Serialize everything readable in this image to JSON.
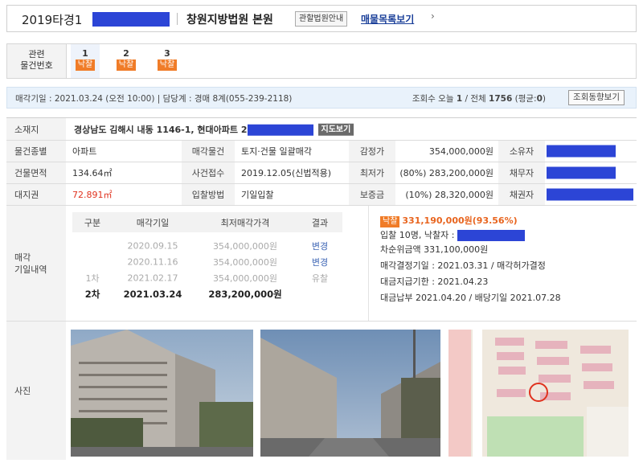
{
  "header": {
    "case_no": "2019타경1",
    "court": "창원지방법원 본원",
    "court_btn": "관할법원안내",
    "list_link": "매물목록보기",
    "chevron": "›"
  },
  "related": {
    "label_line1": "관련",
    "label_line2": "물건번호",
    "items": [
      {
        "num": "1",
        "status": "낙찰"
      },
      {
        "num": "2",
        "status": "낙찰"
      },
      {
        "num": "3",
        "status": "낙찰"
      }
    ]
  },
  "infobar": {
    "left": "매각기일 : 2021.03.24 (오전 10:00) | 담당계 : 경매 8계(055-239-2118)",
    "views_prefix": "조회수 오늘",
    "views_today": "1",
    "views_mid": "/ 전체",
    "views_total": "1756",
    "views_avg_prefix": "(평균:",
    "views_avg": "0",
    "views_avg_suffix": ")",
    "trend_btn": "조회동향보기"
  },
  "table": {
    "location_label": "소재지",
    "location_value": "경상남도 김해시 내동 1146-1, 현대아파트 2",
    "map_btn": "지도보기",
    "type_label": "물건종별",
    "type_value": "아파트",
    "sale_obj_label": "매각물건",
    "sale_obj_value": "토지·건물 일괄매각",
    "appraisal_label": "감정가",
    "appraisal_value": "354,000,000원",
    "owner_label": "소유자",
    "area_label": "건물면적",
    "area_value": "134.64㎡",
    "receipt_label": "사건접수",
    "receipt_value": "2019.12.05(신법적용)",
    "min_label": "최저가",
    "min_value": "(80%) 283,200,000원",
    "debtor_label": "채무자",
    "land_label": "대지권",
    "land_value": "72.891㎡",
    "bid_method_label": "입찰방법",
    "bid_method_value": "기일입찰",
    "deposit_label": "보증금",
    "deposit_value": "(10%) 28,320,000원",
    "creditor_label": "채권자",
    "history_label_line1": "매각",
    "history_label_line2": "기일내역",
    "photo_label": "사진"
  },
  "history": {
    "headers": [
      "구분",
      "매각기일",
      "최저매각가격",
      "결과"
    ],
    "rows": [
      {
        "round": "",
        "date": "2020.09.15",
        "price": "354,000,000원",
        "result": "변경"
      },
      {
        "round": "",
        "date": "2020.11.16",
        "price": "354,000,000원",
        "result": "변경"
      },
      {
        "round": "1차",
        "date": "2021.02.17",
        "price": "354,000,000원",
        "result": "유찰"
      },
      {
        "round": "2차",
        "date": "2021.03.24",
        "price": "283,200,000원",
        "result": ""
      }
    ]
  },
  "result": {
    "badge": "낙찰",
    "amount": "331,190,000원(93.56%)",
    "bidders": "입찰 10명, 낙찰자 :",
    "second": "차순위금액 331,100,000원",
    "decision": "매각결정기일 : 2021.03.31 / 매각허가결정",
    "due": "대금지급기한 : 2021.04.23",
    "paid": "대금납부 2021.04.20 / 배당기일 2021.07.28"
  },
  "colors": {
    "accent_orange": "#f07c28",
    "link_blue": "#1a3f99",
    "redaction": "#2c45d6",
    "land_red": "#e0321e"
  }
}
